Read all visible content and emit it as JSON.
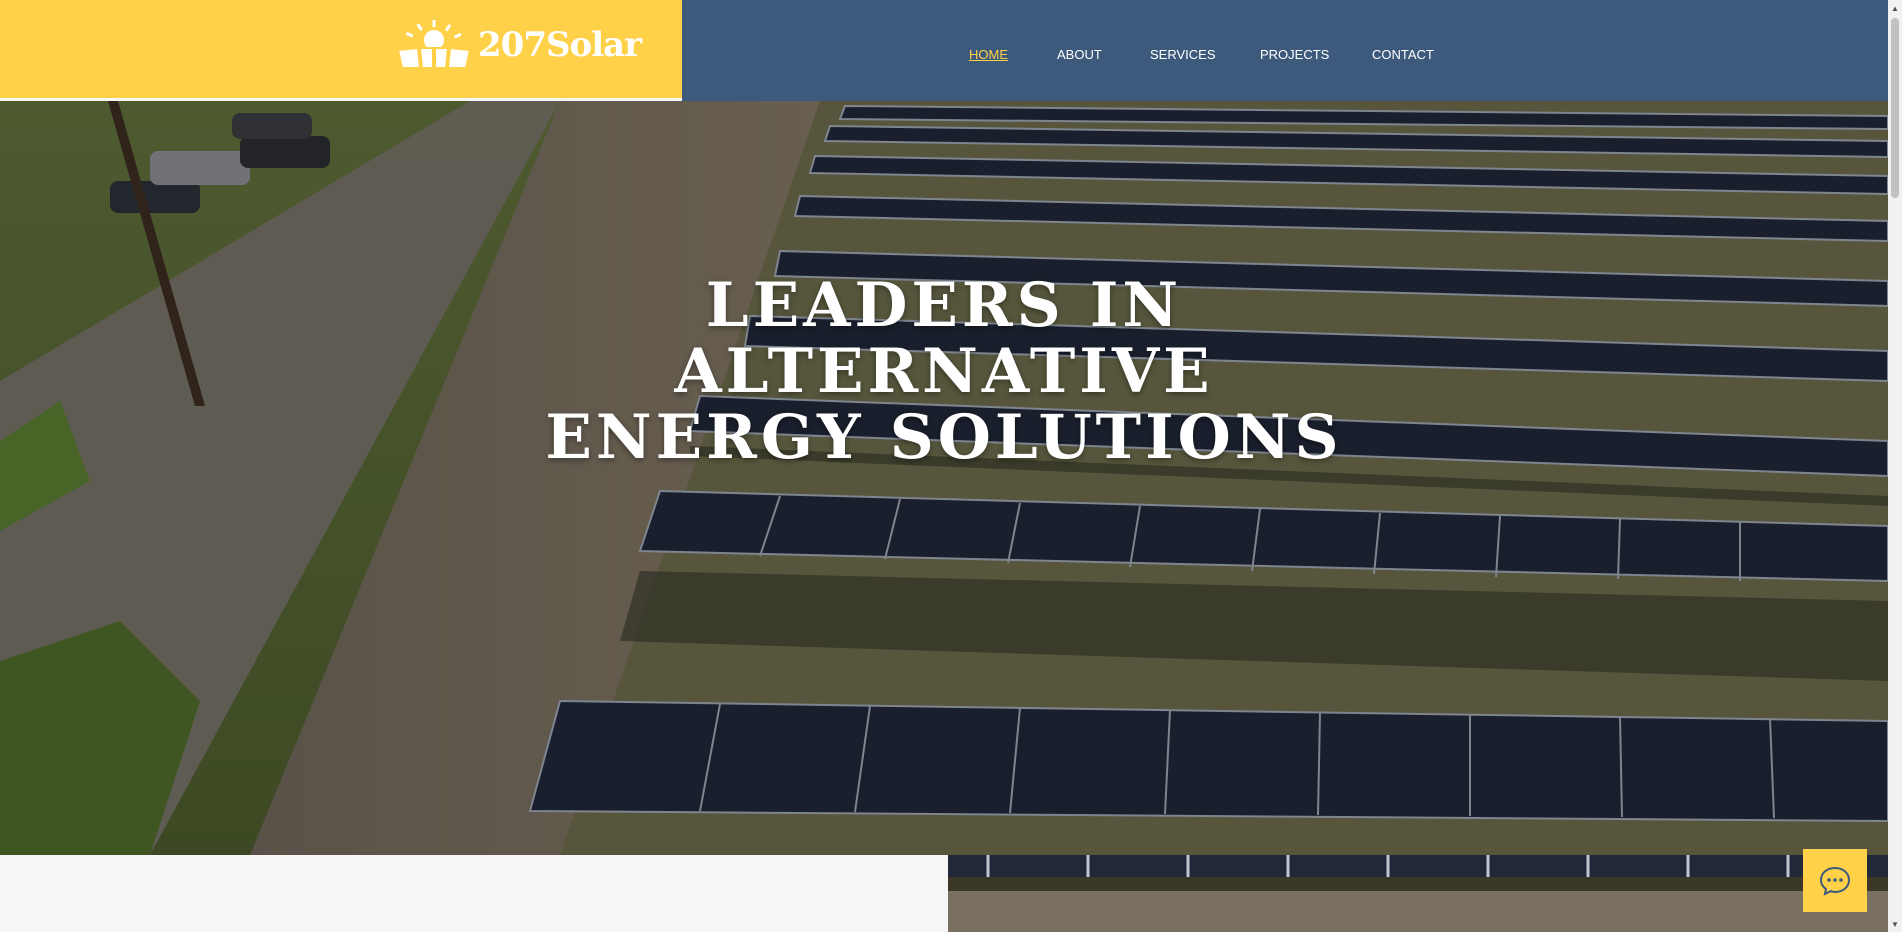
{
  "brand": {
    "name": "207Solar",
    "colors": {
      "yellow": "#ffd149",
      "navy": "#3d5a7c"
    }
  },
  "nav": {
    "items": [
      "HOME",
      "ABOUT",
      "SERVICES",
      "PROJECTS",
      "CONTACT"
    ],
    "active": "HOME"
  },
  "hero": {
    "title_lines": [
      "LEADERS IN",
      "ALTERNATIVE",
      "ENERGY SOLUTIONS"
    ]
  },
  "chat": {
    "icon": "chat-bubble-icon"
  }
}
